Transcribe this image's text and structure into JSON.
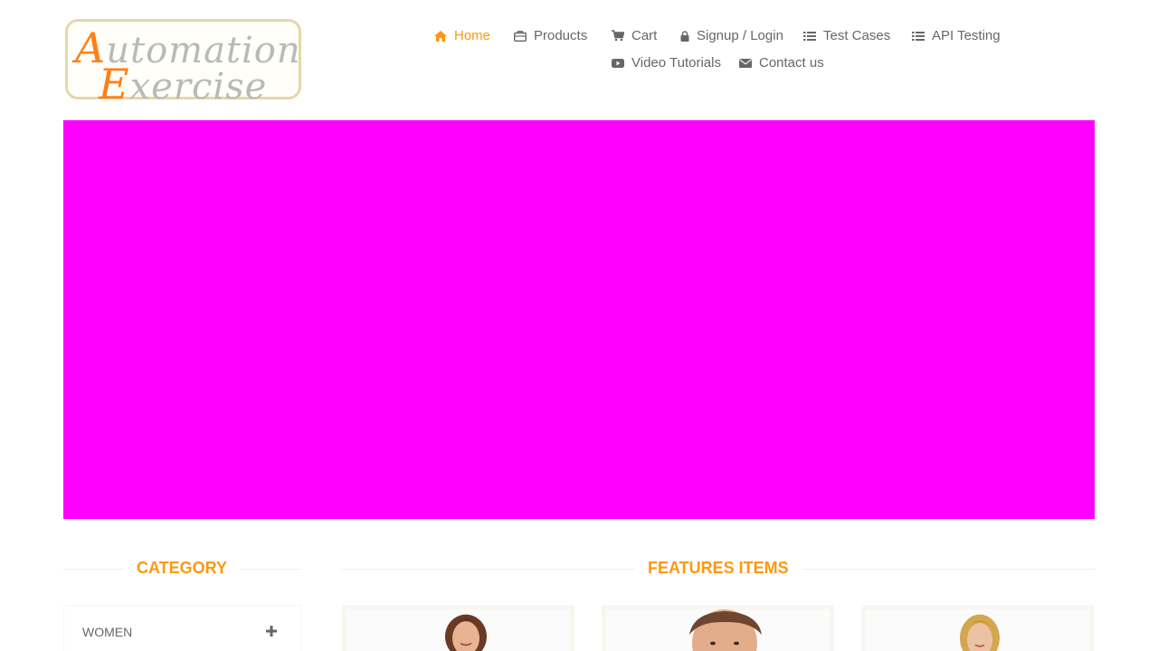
{
  "logo": {
    "line1_first": "A",
    "line1_rest": "utomation",
    "line2_first": "E",
    "line2_rest": "xercise",
    "accent_color": "#ff7f16",
    "text_color": "#b9b9b9"
  },
  "nav": {
    "items": [
      {
        "label": "Home",
        "icon": "home-icon",
        "active": true
      },
      {
        "label": "Products",
        "icon": "briefcase-icon",
        "active": false
      },
      {
        "label": "Cart",
        "icon": "cart-icon",
        "active": false
      },
      {
        "label": "Signup / Login",
        "icon": "lock-icon",
        "active": false
      },
      {
        "label": "Test Cases",
        "icon": "list-icon",
        "active": false
      },
      {
        "label": "API Testing",
        "icon": "list-icon",
        "active": false
      },
      {
        "label": "Video Tutorials",
        "icon": "youtube-play-icon",
        "active": false
      },
      {
        "label": "Contact us",
        "icon": "envelope-icon",
        "active": false
      }
    ],
    "active_color": "#fe980f",
    "default_color": "#696763"
  },
  "hero": {
    "background": "#ff00ff"
  },
  "sidebar": {
    "title": "Category",
    "categories": [
      {
        "label": "Women",
        "icon": "plus-icon"
      }
    ]
  },
  "main": {
    "title": "Features Items",
    "products": [
      {
        "icon": "product-image-woman"
      },
      {
        "icon": "product-image-man"
      },
      {
        "icon": "product-image-woman-blonde"
      }
    ]
  }
}
